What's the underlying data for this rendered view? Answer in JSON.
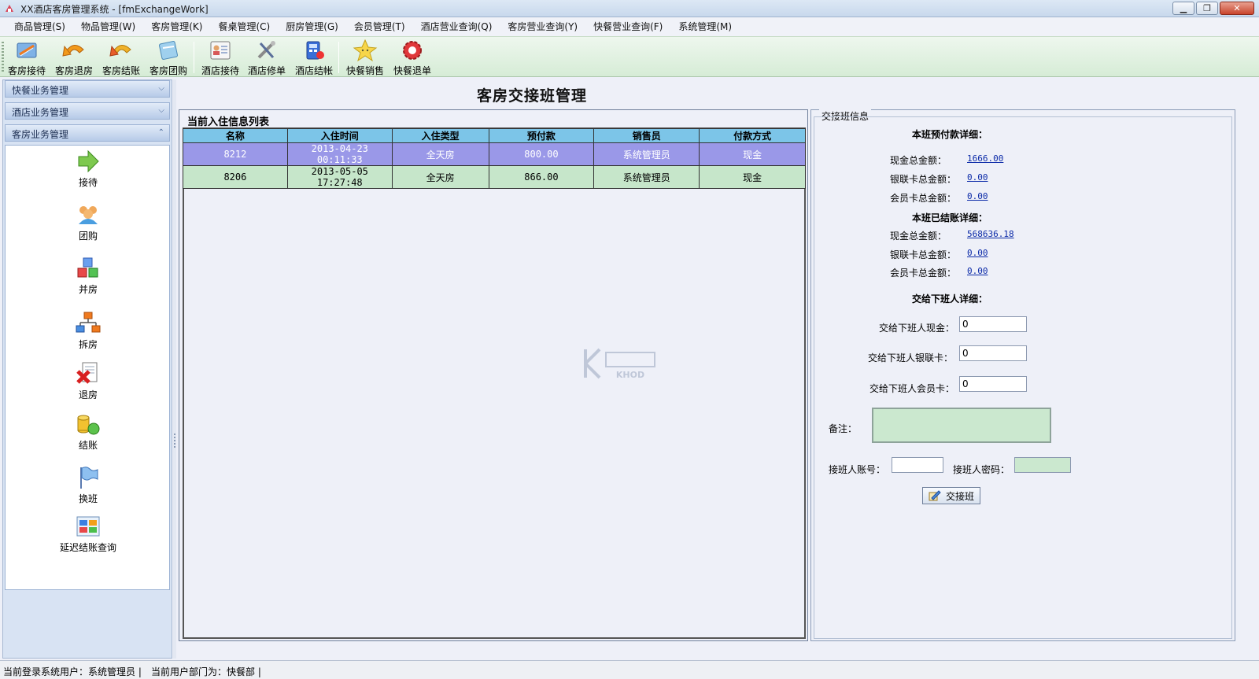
{
  "window": {
    "title": "XX酒店客房管理系统 - [fmExchangeWork]"
  },
  "menu": [
    "商品管理(S)",
    "物品管理(W)",
    "客房管理(K)",
    "餐桌管理(C)",
    "厨房管理(G)",
    "会员管理(T)",
    "酒店营业查询(Q)",
    "客房营业查询(Y)",
    "快餐营业查询(F)",
    "系统管理(M)"
  ],
  "toolbar": {
    "items": [
      "客房接待",
      "客房退房",
      "客房结账",
      "客房团购",
      "酒店接待",
      "酒店修单",
      "酒店结帐",
      "快餐销售",
      "快餐退单"
    ]
  },
  "sidebar": {
    "groups": [
      "快餐业务管理",
      "酒店业务管理",
      "客房业务管理"
    ],
    "items": [
      "接待",
      "团购",
      "并房",
      "拆房",
      "退房",
      "结账",
      "换班",
      "延迟结账查询"
    ]
  },
  "page": {
    "title": "客房交接班管理"
  },
  "checkin_list": {
    "caption": "当前入住信息列表",
    "columns": [
      "名称",
      "入住时间",
      "入住类型",
      "预付款",
      "销售员",
      "付款方式"
    ],
    "rows": [
      [
        "8212",
        "2013-04-23 00:11:33",
        "全天房",
        "800.00",
        "系统管理员",
        "现金"
      ],
      [
        "8206",
        "2013-05-05 17:27:48",
        "全天房",
        "866.00",
        "系统管理员",
        "现金"
      ]
    ]
  },
  "handover": {
    "legend": "交接班信息",
    "prepay_title": "本班预付款详细：",
    "prepay": [
      {
        "label": "现金总金额：",
        "value": "1666.00"
      },
      {
        "label": "银联卡总金额：",
        "value": "0.00"
      },
      {
        "label": "会员卡总金额：",
        "value": "0.00"
      }
    ],
    "settled_title": "本班已结账详细：",
    "settled": [
      {
        "label": "现金总金额：",
        "value": "568636.18"
      },
      {
        "label": "银联卡总金额：",
        "value": "0.00"
      },
      {
        "label": "会员卡总金额：",
        "value": "0.00"
      }
    ],
    "next_title": "交给下班人详细：",
    "next": [
      {
        "label": "交给下班人现金：",
        "value": "0"
      },
      {
        "label": "交给下班人银联卡：",
        "value": "0"
      },
      {
        "label": "交给下班人会员卡：",
        "value": "0"
      }
    ],
    "remark_label": "备注：",
    "remark_value": "",
    "account_label": "接班人账号：",
    "account_value": "",
    "password_label": "接班人密码：",
    "password_value": "",
    "submit_label": "交接班"
  },
  "status": {
    "user": "当前登录系统用户：系统管理员 |",
    "dept": "当前用户部门为：快餐部 |"
  },
  "watermark": {
    "text": "KHOD"
  },
  "colors": {
    "header_blue": "#7cc5e8",
    "selected_row": "#9a98e8",
    "normal_row": "#c6e6ca",
    "input_green": "#cbe8cf",
    "link_blue": "#0b2aa8"
  }
}
